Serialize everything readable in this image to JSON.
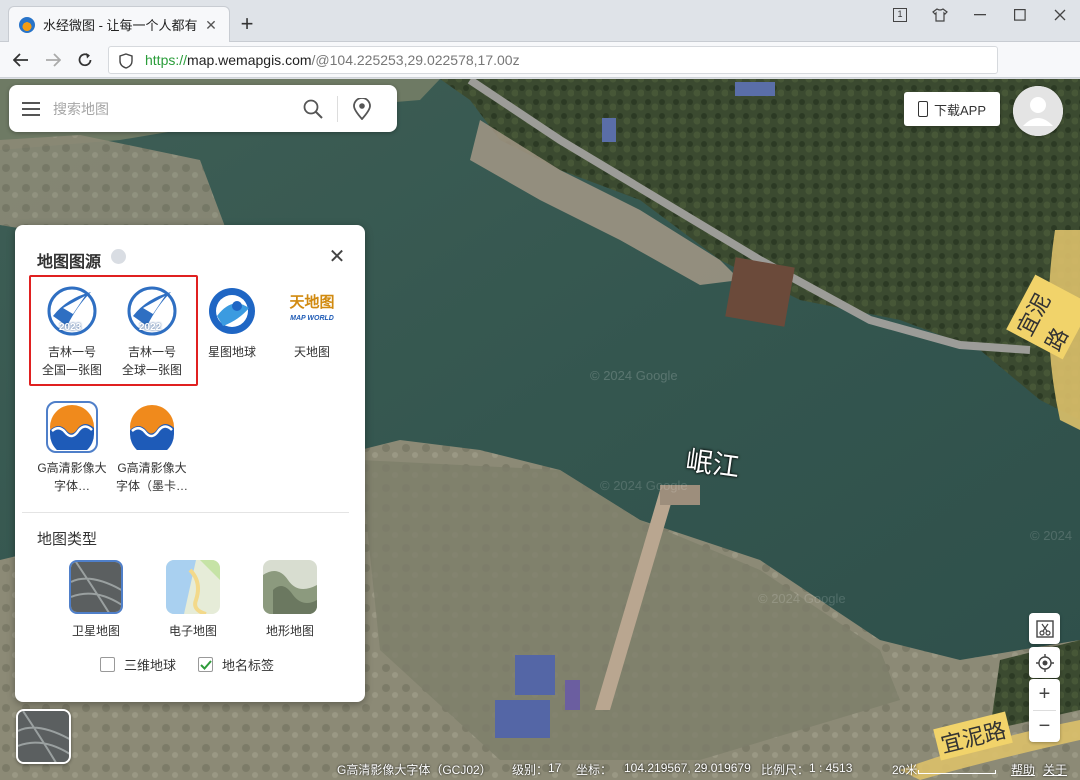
{
  "browser": {
    "tab_title": "水经微图 - 让每一个人都有自",
    "tab_counter": "1",
    "url_scheme": "https://",
    "url_host": "map.wemapgis.com",
    "url_path": "/@104.225253,29.022578,17.00z"
  },
  "search": {
    "placeholder": "搜索地图"
  },
  "header": {
    "download_label": "下载APP"
  },
  "source_panel": {
    "title": "地图图源",
    "sources": [
      {
        "label": "吉林一号\n全国一张图",
        "year": "2023"
      },
      {
        "label": "吉林一号\n全球一张图",
        "year": "2022"
      },
      {
        "label": "星图地球"
      },
      {
        "label": "天地图",
        "logo_text": "天地图",
        "logo_sub": "MAP WORLD"
      },
      {
        "label": "G高清影像大字体…",
        "selected": true
      },
      {
        "label": "G高清影像大字体（墨卡…"
      }
    ],
    "type_title": "地图类型",
    "map_types": [
      {
        "label": "卫星地图",
        "selected": true
      },
      {
        "label": "电子地图"
      },
      {
        "label": "地形地图"
      }
    ],
    "options": [
      {
        "label": "三维地球",
        "checked": false
      },
      {
        "label": "地名标签",
        "checked": true
      }
    ]
  },
  "map": {
    "labels": {
      "river": "岷江",
      "road_top": "宜泥路",
      "road_bottom": "宜泥路"
    },
    "watermark": "© 2024 Google"
  },
  "status": {
    "layer_name": "G高清影像大字体（GCJ02）",
    "level_label": "级别：",
    "level": "17",
    "coord_label": "坐标：",
    "coords": "104.219567, 29.019679",
    "scale_label": "比例尺：",
    "scale": "1 : 4513",
    "scale_bar": "20米",
    "help": "帮助",
    "about": "关于"
  },
  "colors": {
    "accent": "#4f7fc9",
    "highlight_box": "#e02020",
    "url_green": "#2a9d3a"
  }
}
